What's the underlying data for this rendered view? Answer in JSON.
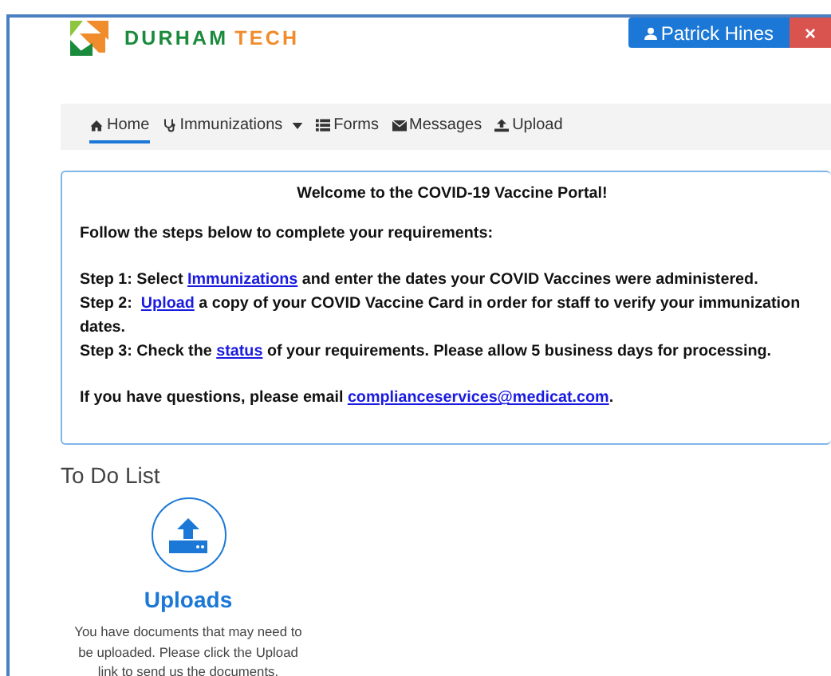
{
  "header": {
    "logo_left": "DURHAM",
    "logo_right": "TECH",
    "user_button": "Patrick Hines",
    "close_button": "×"
  },
  "nav": [
    {
      "label": "Home",
      "selected": true,
      "dropdown": false
    },
    {
      "label": "Immunizations",
      "selected": false,
      "dropdown": true
    },
    {
      "label": "Forms",
      "selected": false,
      "dropdown": false
    },
    {
      "label": "Messages",
      "selected": false,
      "dropdown": false
    },
    {
      "label": "Upload",
      "selected": false,
      "dropdown": false
    }
  ],
  "welcome": {
    "title": "Welcome to the COVID-19 Vaccine Portal!",
    "paragraphs": [
      {
        "lines": [
          [
            {
              "kind": "text",
              "text": "Follow the steps below to complete your requirements:"
            }
          ]
        ]
      },
      {
        "lines": [
          [
            {
              "kind": "text",
              "text": "Step 1: Select "
            },
            {
              "kind": "link",
              "text": "Immunizations"
            },
            {
              "kind": "text",
              "text": " and enter the dates your COVID Vaccines were administered."
            }
          ],
          [
            {
              "kind": "text",
              "text": "Step 2:  "
            },
            {
              "kind": "link",
              "text": "Upload"
            },
            {
              "kind": "text",
              "text": " a copy of your COVID Vaccine Card in order for staff to verify your immunization dates."
            }
          ],
          [
            {
              "kind": "text",
              "text": "Step 3: Check the "
            },
            {
              "kind": "link",
              "text": "status"
            },
            {
              "kind": "text",
              "text": " of your requirements. Please allow 5 business days for processing."
            }
          ]
        ]
      },
      {
        "lines": [
          [
            {
              "kind": "text",
              "text": "If you have questions, please email "
            },
            {
              "kind": "link",
              "text": "complianceservices@medicat.com"
            },
            {
              "kind": "text",
              "text": "."
            }
          ]
        ]
      }
    ]
  },
  "todo": {
    "heading": "To Do List",
    "items": [
      {
        "title": "Uploads",
        "description": "You have documents that may need to be uploaded. Please click the Upload link to send us the documents."
      }
    ]
  }
}
